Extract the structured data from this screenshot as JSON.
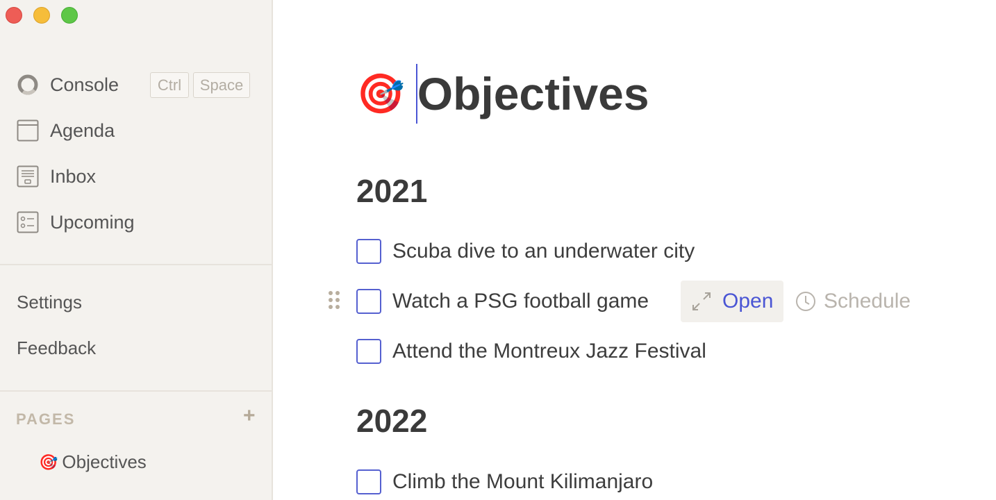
{
  "sidebar": {
    "nav": [
      {
        "label": "Console",
        "icon": "console-ring-icon"
      },
      {
        "label": "Agenda",
        "icon": "agenda-icon"
      },
      {
        "label": "Inbox",
        "icon": "inbox-icon"
      },
      {
        "label": "Upcoming",
        "icon": "upcoming-icon"
      }
    ],
    "shortcut": {
      "key1": "Ctrl",
      "key2": "Space"
    },
    "settings_label": "Settings",
    "feedback_label": "Feedback",
    "pages_label": "PAGES",
    "add_page_label": "+",
    "pages": [
      {
        "label": "Objectives",
        "icon": "🎯"
      }
    ]
  },
  "document": {
    "emoji": "🎯",
    "title": "Objectives",
    "sections": [
      {
        "year": "2021",
        "tasks": [
          {
            "text": "Scuba dive to an underwater city",
            "checked": false
          },
          {
            "text": "Watch a PSG football game",
            "checked": false
          },
          {
            "text": "Attend the Montreux Jazz Festival",
            "checked": false
          }
        ]
      },
      {
        "year": "2022",
        "tasks": [
          {
            "text": "Climb the Mount Kilimanjaro",
            "checked": false
          }
        ]
      }
    ],
    "hover_actions": {
      "open_label": "Open",
      "schedule_label": "Schedule"
    }
  },
  "colors": {
    "accent": "#4a55d4",
    "sidebar_bg": "#f4f2ee",
    "close": "#ee5d56",
    "minimize": "#f6bd3a",
    "maximize": "#5ec747"
  }
}
